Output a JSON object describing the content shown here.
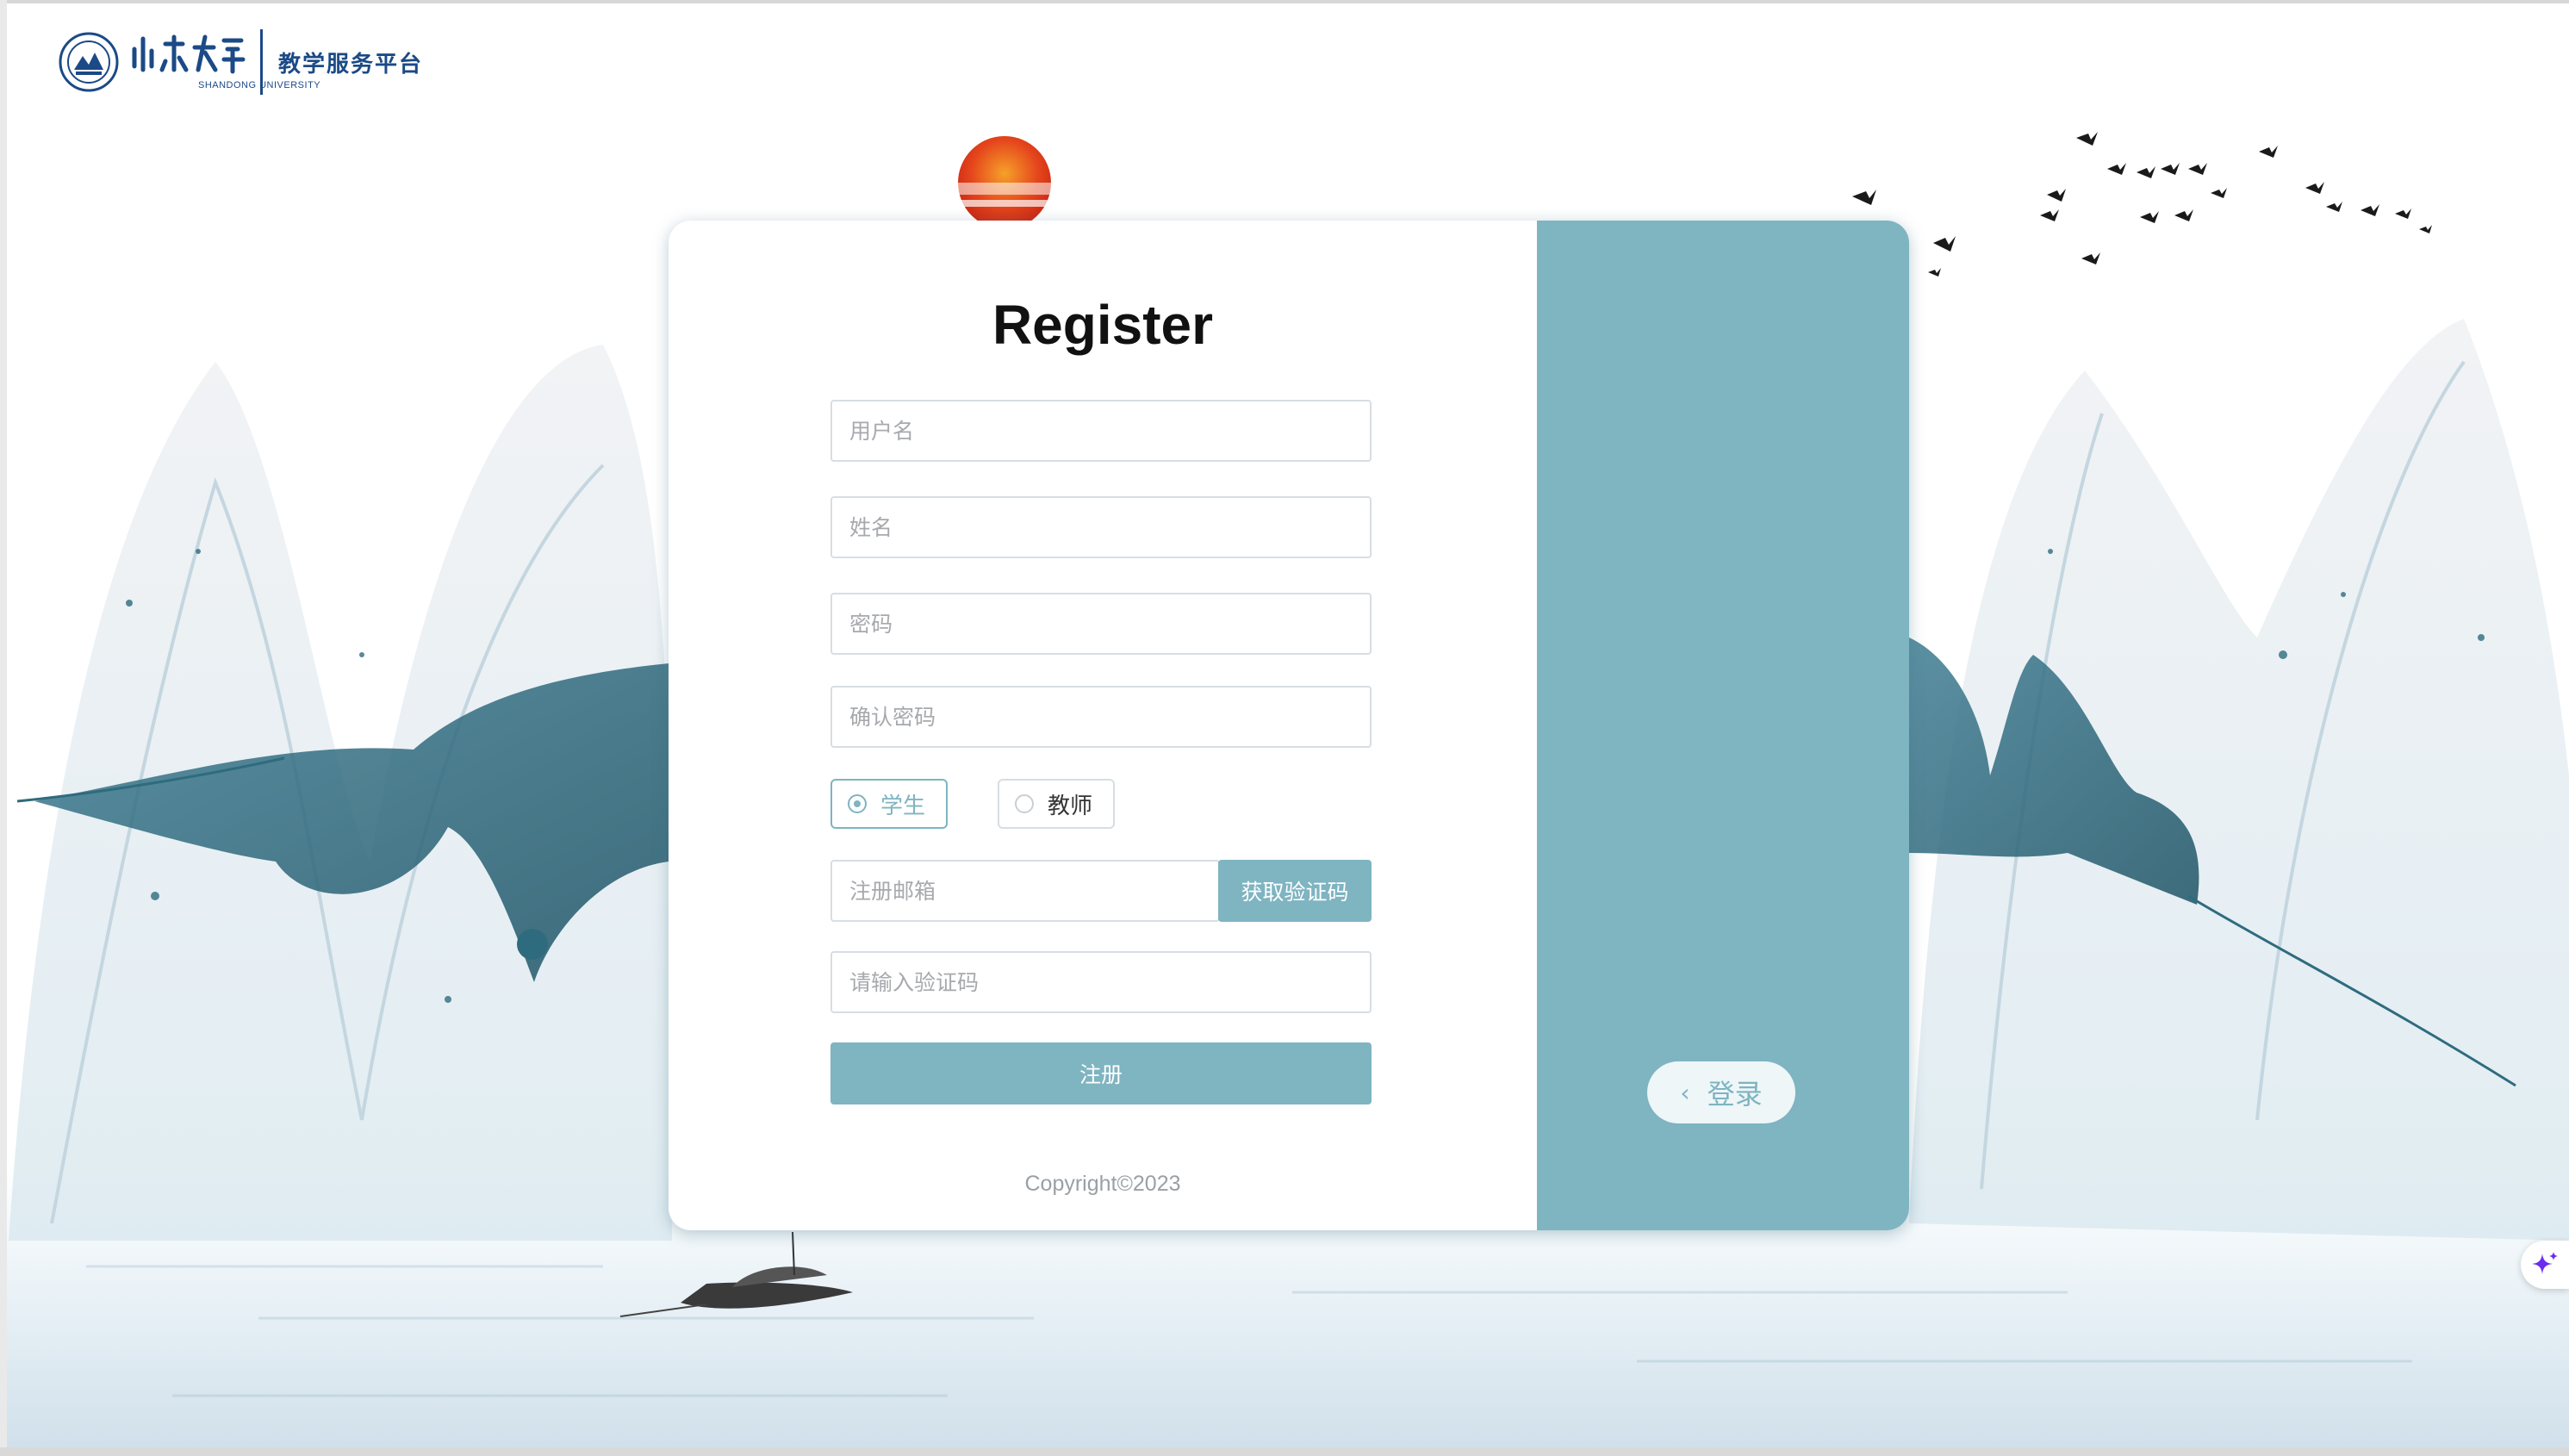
{
  "header": {
    "university_logo_text": "山东大学",
    "university_subtitle": "SHANDONG UNIVERSITY",
    "platform_title": "教学服务平台"
  },
  "form": {
    "title": "Register",
    "username_placeholder": "用户名",
    "name_placeholder": "姓名",
    "password_placeholder": "密码",
    "confirm_password_placeholder": "确认密码",
    "role_options": [
      {
        "label": "学生",
        "selected": true
      },
      {
        "label": "教师",
        "selected": false
      }
    ],
    "email_placeholder": "注册邮箱",
    "get_code_label": "获取验证码",
    "code_placeholder": "请输入验证码",
    "register_label": "注册",
    "copyright": "Copyright©2023"
  },
  "side_panel": {
    "login_label": "登录",
    "login_icon": "chevron-left-icon"
  },
  "colors": {
    "accent": "#7fb4c1",
    "brand_blue": "#1b4a86",
    "card_bg": "#ffffff"
  }
}
